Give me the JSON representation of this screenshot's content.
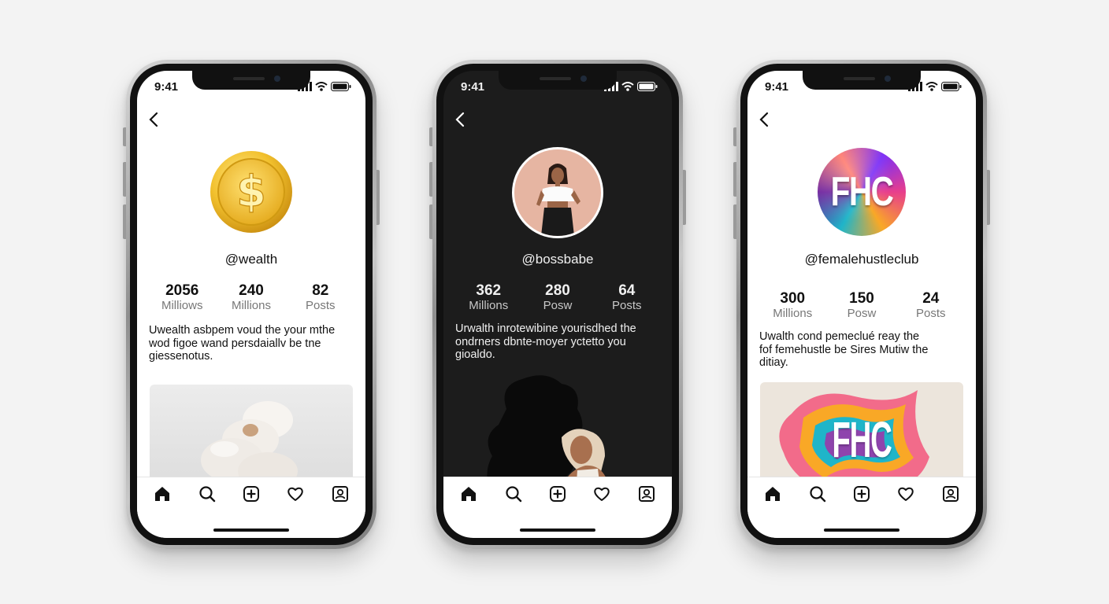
{
  "phones": [
    {
      "status_time": "9:41",
      "handle": "@wealth",
      "stats": [
        {
          "value": "2056",
          "label": "Milliows"
        },
        {
          "value": "240",
          "label": "Millions"
        },
        {
          "value": "82",
          "label": "Posts"
        }
      ],
      "bio": [
        "Uwealth asbpem voud the your mthe",
        "wod figoe wand persdaiallv be tne",
        "giessenotus."
      ],
      "avatar_icon": "gold-coin-dollar-icon"
    },
    {
      "status_time": "9:41",
      "handle": "@bossbabe",
      "stats": [
        {
          "value": "362",
          "label": "Millions"
        },
        {
          "value": "280",
          "label": "Posw"
        },
        {
          "value": "64",
          "label": "Posts"
        }
      ],
      "bio": [
        "Urwalth inrotewibine yourisdhed the",
        "ondrners dbnte-moyer yctetto you",
        "gioaldo."
      ],
      "avatar_icon": "woman-illustration"
    },
    {
      "status_time": "9:41",
      "handle": "@femalehustleclub",
      "stats": [
        {
          "value": "300",
          "label": "Millions"
        },
        {
          "value": "150",
          "label": "Posw"
        },
        {
          "value": "24",
          "label": "Posts"
        }
      ],
      "bio": [
        "Uwalth cond pemeclué reay the",
        "fof femehustle be Sires Mutiw the",
        "ditiay."
      ],
      "avatar_text": "FHC",
      "media_text": "FHC"
    }
  ],
  "tabbar_icons": [
    "home-icon",
    "search-icon",
    "add-post-icon",
    "heart-icon",
    "profile-icon"
  ]
}
